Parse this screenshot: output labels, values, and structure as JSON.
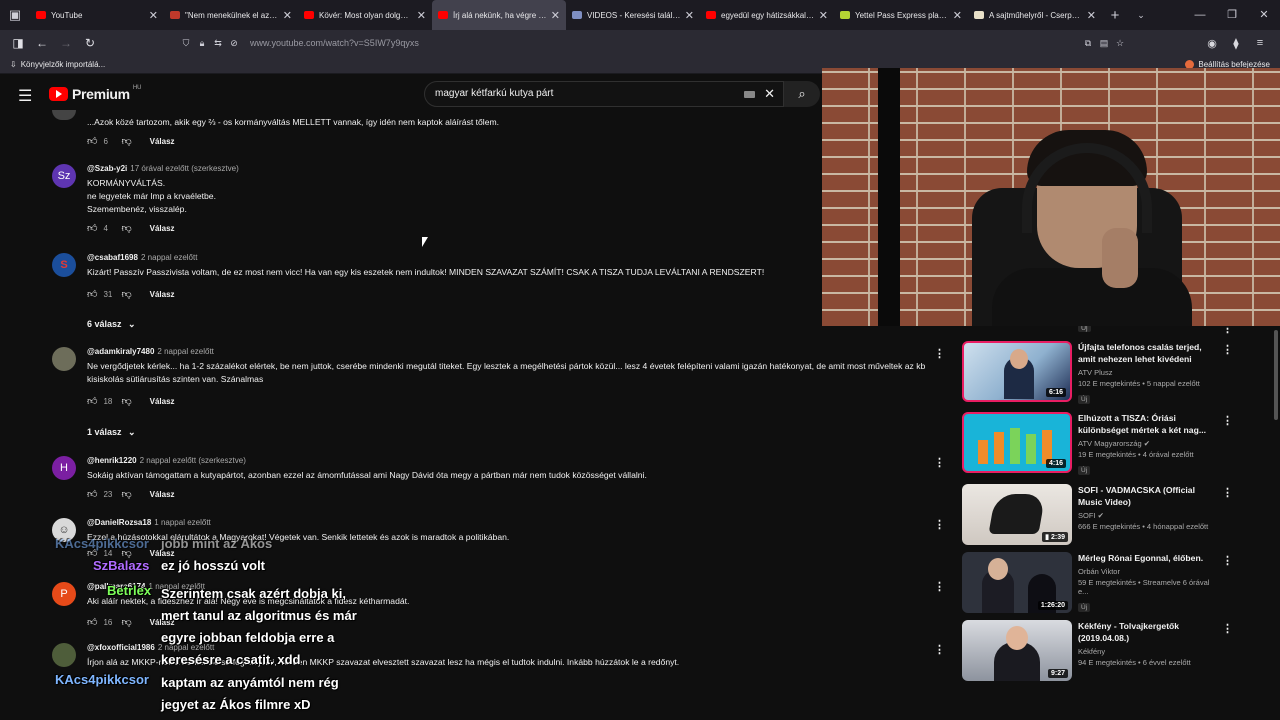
{
  "browser": {
    "tabs": [
      {
        "title": "YouTube",
        "favicon_color": "#ff0000",
        "active": false
      },
      {
        "title": "\"Nem menekülnek el az em",
        "favicon_color": "#c0392b",
        "active": false
      },
      {
        "title": "Kövér: Most olyan dolgot c",
        "favicon_color": "#ff0000",
        "active": false
      },
      {
        "title": "Írj alá nekünk, ha végre nem",
        "favicon_color": "#ff0000",
        "active": true
      },
      {
        "title": "VIDEOS - Keresési találatok",
        "favicon_color": "#7f8fc2",
        "active": false
      },
      {
        "title": "egyedül egy hátizsákkal az",
        "favicon_color": "#ff0000",
        "active": false
      },
      {
        "title": "Yettel Pass Express plan - E",
        "favicon_color": "#b5d334",
        "active": false
      },
      {
        "title": "A sajtműhelyről - Cserpes S",
        "favicon_color": "#e8e0c8",
        "active": false
      }
    ],
    "url": "www.youtube.com/watch?v=S5IW7y9qyxs",
    "bookmarks_label": "Könyvjelzők importálá...",
    "settings_label": "Beállítás befejezése"
  },
  "youtube": {
    "brand": "Premium",
    "country": "HU",
    "search_query": "magyar kétfarkú kutya párt"
  },
  "comments": [
    {
      "author": "",
      "ago": "",
      "text": "...Azok közé tartozom, akik egy ⅔ - os kormányváltás MELLETT vannak, így idén nem kaptok aláírást tőlem.",
      "likes": "6",
      "reply_label": "Válasz"
    },
    {
      "author": "@Szab-y2i",
      "ago": "17 órával ezelőtt (szerkesztve)",
      "avatar_text": "Sz",
      "text": "KORMÁNYVÁLTÁS.\nne legyetek már lmp a krvaéletbe.\nSzemembenéz, visszalép.",
      "likes": "4",
      "reply_label": "Válasz"
    },
    {
      "author": "@csabaf1698",
      "ago": "2 nappal ezelőtt",
      "text": "Kizárt! Passzív Passzivista voltam, de ez most nem vicc! Ha van egy kis eszetek nem indultok! MINDEN SZAVAZAT SZÁMÍT! CSAK A TISZA TUDJA LEVÁLTANI A RENDSZERT!",
      "likes": "31",
      "reply_label": "Válasz",
      "replies": "6 válasz"
    },
    {
      "author": "@adamkiraly7480",
      "ago": "2 nappal ezelőtt",
      "text": "Ne vergődjetek kérlek... ha 1-2 százalékot elértek, be nem juttok, cserébe mindenki megutál titeket. Egy lesztek a megélhetési pártok közül... lesz 4 évetek felépíteni valami igazán hatékonyat, de amit most műveltek az kb kisiskolás sütiárusítás szinten van. Szánalmas",
      "likes": "18",
      "reply_label": "Válasz",
      "replies": "1 válasz"
    },
    {
      "author": "@henrik1220",
      "ago": "2 nappal ezelőtt (szerkesztve)",
      "avatar_text": "H",
      "text": "Sokáig aktívan támogattam a kutyapártot, azonban ezzel az ámomfutással ami Nagy Dávid óta megy a pártban már nem tudok közösséget vállalni.",
      "likes": "23",
      "reply_label": "Válasz"
    },
    {
      "author": "@DanielRozsa18",
      "ago": "1 nappal ezelőtt",
      "text": "Ezzel a húzásotokkal elárultátok a Magyarokat! Végetek van. Senkik lettetek és azok is maradtok a politikában.",
      "likes": "14",
      "reply_label": "Válasz"
    },
    {
      "author": "@pallmarc6174",
      "ago": "1 nappal ezelőtt",
      "avatar_text": "P",
      "text": "Aki aláír nektek, a fideszhez ír alá! Négy éve is megcsináltátok a fidesz kétharmadát.",
      "likes": "16",
      "reply_label": "Válasz"
    },
    {
      "author": "@xfoxofficial1986",
      "ago": "2 nappal ezelőtt",
      "text": "Írjon alá az MKKP-nak a hóher. Be se fogtok jutni, minden MKKP szavazat elvesztett szavazat lesz ha mégis el tudtok indulni. Inkább húzzátok le a redőnyt.",
      "likes": "",
      "reply_label": ""
    }
  ],
  "recommendations": [
    {
      "title": "Újfajta telefonos csalás terjed, amit nehezen lehet kivédeni",
      "channel": "ATV Plusz",
      "stats": "102 E megtekintés • 5 nappal ezelőtt",
      "badge": "Új",
      "duration": "6:16",
      "thumb_color": "#a9c1d6"
    },
    {
      "title": "Elhúzott a TISZA: Óriási különbséget mértek a két nag...",
      "channel": "ATV Magyarország",
      "stats": "19 E megtekintés • 4 órával ezelőtt",
      "badge": "Új",
      "duration": "4:16",
      "thumb_color": "#2aa4c8"
    },
    {
      "title": "SOFI - VADMACSKA (Official Music Video)",
      "channel": "SOFI",
      "stats": "666 E megtekintés • 4 hónappal ezelőtt",
      "badge": "",
      "duration": "2:39",
      "thumb_color": "#d8d3cf"
    },
    {
      "title": "Mérleg Rónai Egonnal, élőben.",
      "channel": "Orbán Viktor",
      "stats": "59 E megtekintés • Streamelve 6 órával e...",
      "badge": "Új",
      "duration": "1:26:20",
      "thumb_color": "#3a3f4a"
    },
    {
      "title": "Kékfény - Tolvajkergetők (2019.04.08.)",
      "channel": "Kékfény",
      "stats": "94 E megtekintés • 6 évvel ezelőtt",
      "badge": "",
      "duration": "9:27",
      "thumb_color": "#556070"
    }
  ],
  "top_rec_badge": "Új",
  "chat": [
    {
      "name": "KAcs4pikkcsor",
      "name_color": "#7fb6ff",
      "text": "jobb mint az Ákos"
    },
    {
      "name": "SzBalazs",
      "name_color": "#b06bff",
      "text": "ez jó hosszú volt"
    },
    {
      "name": "Betrlex",
      "name_color": "#7dff5a",
      "text": "Szerintem csak azért dobja ki,\nmert tanul az algoritmus és már\negyre jobban feldobja erre a\nkeresésre a csatit. xdd"
    },
    {
      "name": "KAcs4pikkcsor",
      "name_color": "#7fb6ff",
      "text": "kaptam az anyámtól nem rég\njegyet az Ákos filmre xD"
    }
  ]
}
